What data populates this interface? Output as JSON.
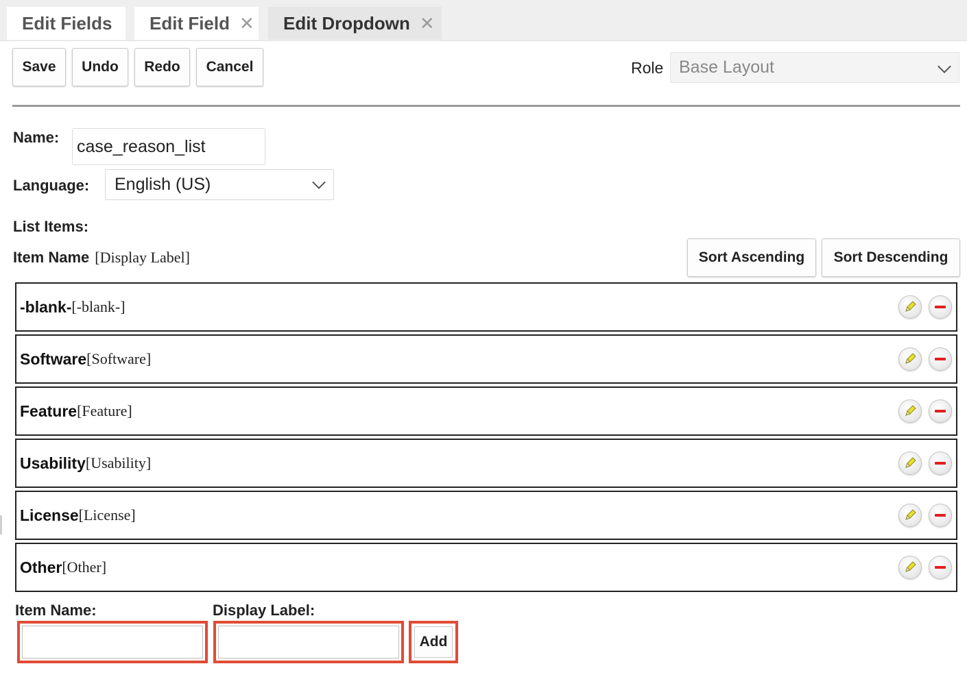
{
  "tabs": [
    {
      "label": "Edit Fields",
      "closable": false
    },
    {
      "label": "Edit Field",
      "closable": true
    },
    {
      "label": "Edit Dropdown",
      "closable": true,
      "active": true
    }
  ],
  "tab_close_glyph": "✕",
  "toolbar": {
    "save": "Save",
    "undo": "Undo",
    "redo": "Redo",
    "cancel": "Cancel"
  },
  "role": {
    "label": "Role",
    "value": "Base Layout"
  },
  "form": {
    "name_label": "Name:",
    "name_value": "case_reason_list",
    "language_label": "Language:",
    "language_value": "English (US)",
    "list_items_label": "List Items:"
  },
  "list_header": {
    "item_name": "Item Name",
    "display_label": "[Display Label]"
  },
  "sort": {
    "ascending": "Sort Ascending",
    "descending": "Sort Descending"
  },
  "items": [
    {
      "name": "-blank-",
      "label": "[-blank-]"
    },
    {
      "name": "Software",
      "label": "[Software]"
    },
    {
      "name": "Feature",
      "label": "[Feature]"
    },
    {
      "name": "Usability",
      "label": "[Usability]"
    },
    {
      "name": "License",
      "label": "[License]"
    },
    {
      "name": "Other",
      "label": "[Other]"
    }
  ],
  "row_icons": {
    "edit": "pencil-icon",
    "remove": "minus-circle-icon"
  },
  "add_form": {
    "item_name_label": "Item Name:",
    "display_label_label": "Display Label:",
    "add_button": "Add"
  },
  "colors": {
    "highlight": "#e14b35",
    "remove_red": "#e02020",
    "pencil_yellow": "#e8e02a"
  }
}
